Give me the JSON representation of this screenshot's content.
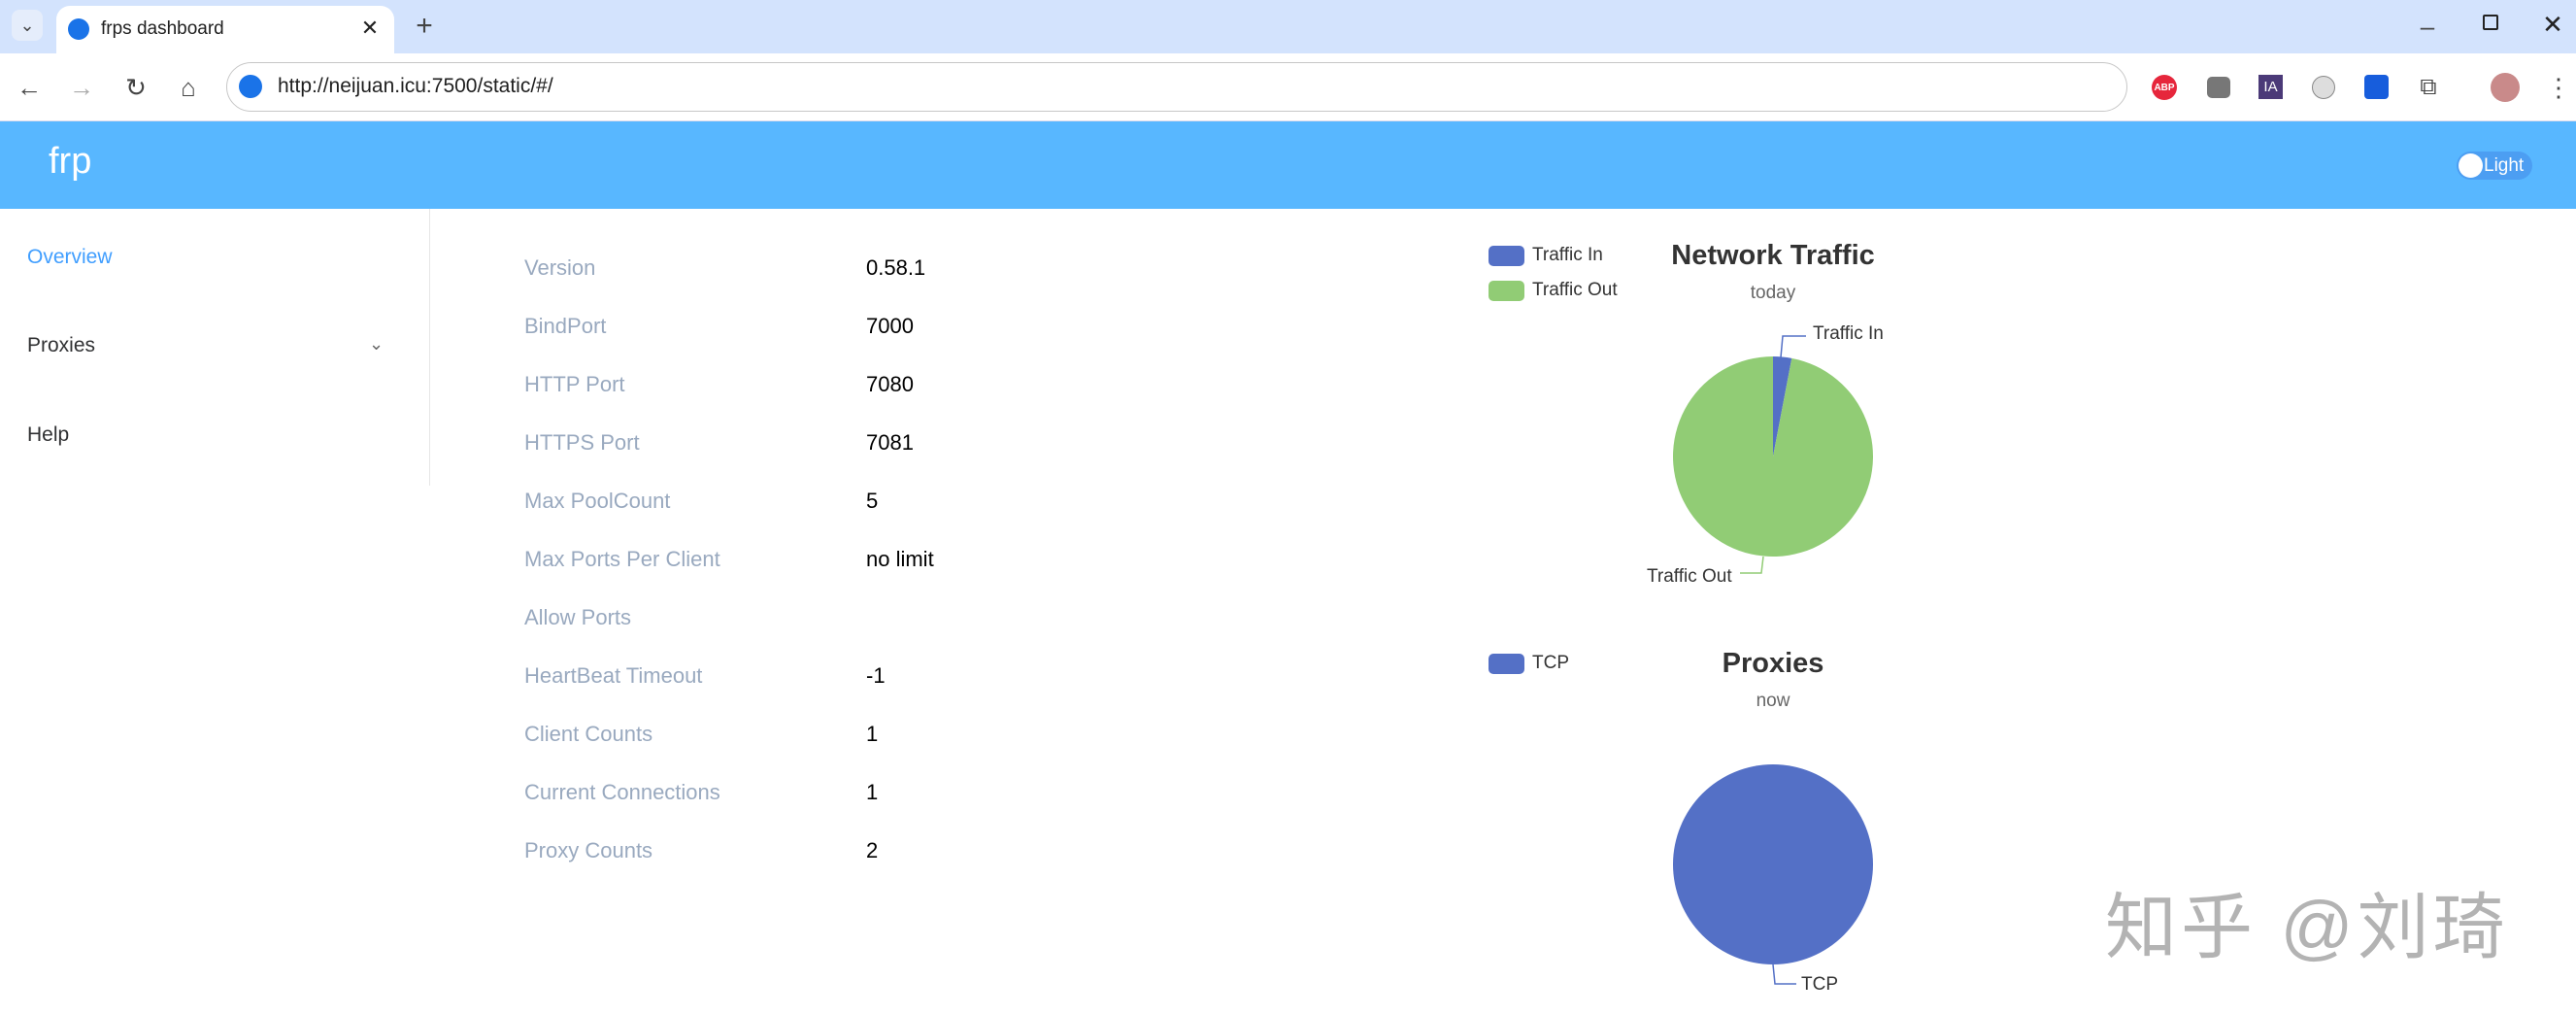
{
  "browser": {
    "tab_title": "frps dashboard",
    "url": "http://neijuan.icu:7500/static/#/",
    "extensions": [
      "adblock-plus-icon",
      "tampermonkey-icon",
      "ia-icon",
      "cloud-icon",
      "bitwarden-icon",
      "puzzle-icon"
    ],
    "ext_abp": "ABP",
    "ext_ia": "IA"
  },
  "header": {
    "logo": "frp",
    "theme_toggle": "Light",
    "color": "#58b7ff"
  },
  "sidebar": {
    "items": [
      {
        "label": "Overview",
        "active": true
      },
      {
        "label": "Proxies"
      },
      {
        "label": "Help"
      }
    ],
    "active_color": "#409eff"
  },
  "info": [
    {
      "label": "Version",
      "value": "0.58.1"
    },
    {
      "label": "BindPort",
      "value": "7000"
    },
    {
      "label": "HTTP Port",
      "value": "7080"
    },
    {
      "label": "HTTPS Port",
      "value": "7081"
    },
    {
      "label": "Max PoolCount",
      "value": "5"
    },
    {
      "label": "Max Ports Per Client",
      "value": "no limit"
    },
    {
      "label": "Allow Ports",
      "value": ""
    },
    {
      "label": "HeartBeat Timeout",
      "value": "-1"
    },
    {
      "label": "Client Counts",
      "value": "1"
    },
    {
      "label": "Current Connections",
      "value": "1"
    },
    {
      "label": "Proxy Counts",
      "value": "2"
    }
  ],
  "chart_data": [
    {
      "type": "pie",
      "title": "Network Traffic",
      "subtitle": "today",
      "legend_placement": "top-left",
      "series": [
        {
          "name": "Traffic In",
          "value": 3,
          "color": "#5470c6"
        },
        {
          "name": "Traffic Out",
          "value": 97,
          "color": "#91cc75"
        }
      ]
    },
    {
      "type": "pie",
      "title": "Proxies",
      "subtitle": "now",
      "legend_placement": "top-left",
      "series": [
        {
          "name": "TCP",
          "value": 100,
          "color": "#5470c6"
        }
      ]
    }
  ],
  "watermark": "知乎 @刘琦"
}
